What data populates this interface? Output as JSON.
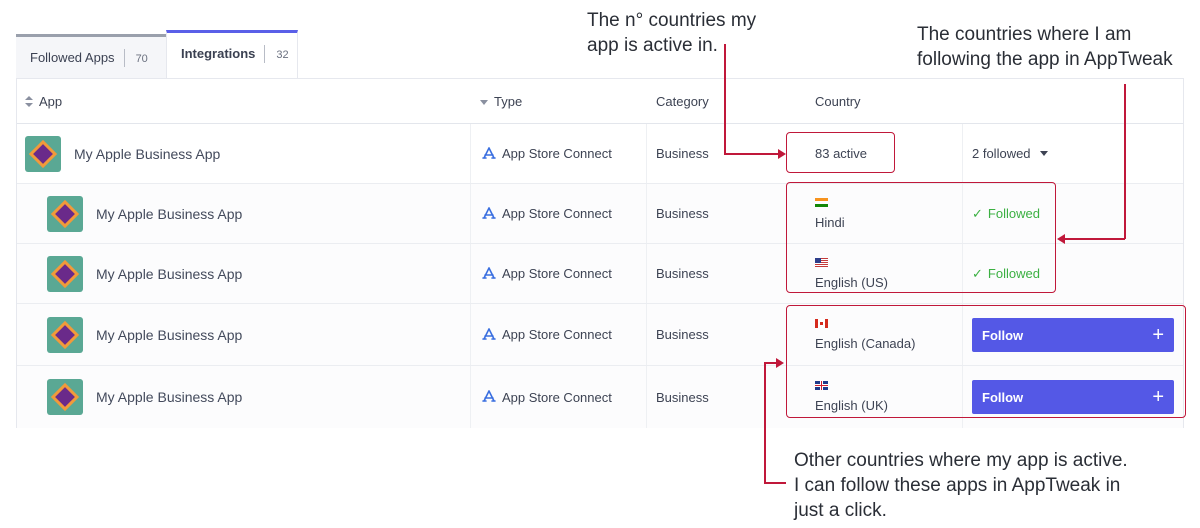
{
  "tabs": [
    {
      "label": "Followed Apps",
      "count": "70"
    },
    {
      "label": "Integrations",
      "count": "32"
    }
  ],
  "table": {
    "headers": {
      "app": "App",
      "type": "Type",
      "category": "Category",
      "country": "Country"
    },
    "parent_row": {
      "app_name": "My Apple Business App",
      "type": "App Store Connect",
      "category": "Business",
      "country_summary": "83 active",
      "followed_summary": "2 followed"
    },
    "child_rows": [
      {
        "app_name": "My Apple Business App",
        "type": "App Store Connect",
        "category": "Business",
        "country": "Hindi",
        "flag": "india-flag",
        "status": "Followed"
      },
      {
        "app_name": "My Apple Business App",
        "type": "App Store Connect",
        "category": "Business",
        "country": "English (US)",
        "flag": "us-flag",
        "status": "Followed"
      },
      {
        "app_name": "My Apple Business App",
        "type": "App Store Connect",
        "category": "Business",
        "country": "English (Canada)",
        "flag": "canada-flag",
        "action": "Follow"
      },
      {
        "app_name": "My Apple Business App",
        "type": "App Store Connect",
        "category": "Business",
        "country": "English (UK)",
        "flag": "uk-flag",
        "action": "Follow"
      }
    ]
  },
  "annotations": {
    "active_count": [
      "The n° countries my",
      "app is active in."
    ],
    "followed_countries": [
      "The countries where I am",
      "following the app in AppTweak"
    ],
    "other_countries": [
      "Other countries where my app is active.",
      "I can follow these apps in AppTweak in",
      "just a click."
    ]
  },
  "colors": {
    "accent": "#5458e6",
    "followed_green": "#3cb043",
    "annotation_red": "#c0183a",
    "app_icon_bg": "#5aa894"
  }
}
